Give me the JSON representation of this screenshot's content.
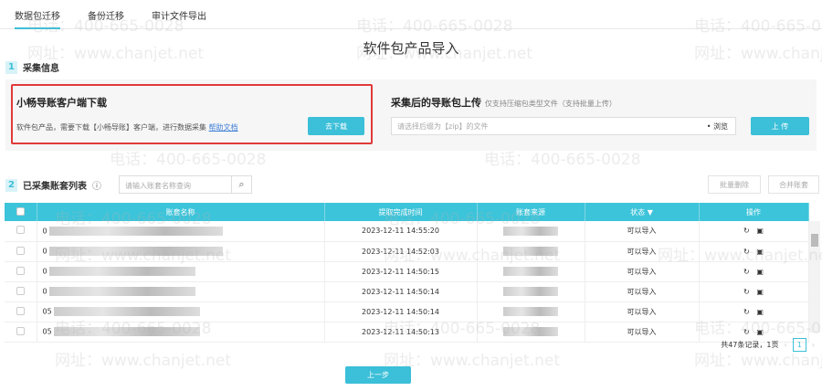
{
  "tabs": [
    "数据包迁移",
    "备份迁移",
    "审计文件导出"
  ],
  "title": "软件包产品导入",
  "section1": {
    "num": "1",
    "label": "采集信息"
  },
  "download": {
    "title": "小畅导账客户端下载",
    "desc": "软件包产品，需要下载【小畅导账】客户端，进行数据采集",
    "help": "帮助文档",
    "button": "去下载"
  },
  "upload": {
    "title": "采集后的导账包上传",
    "hint": "仅支持压缩包类型文件（支持批量上传）",
    "placeholder": "请选择后缀为【zip】的文件",
    "browse": "浏览",
    "button": "上 传"
  },
  "section2": {
    "num": "2",
    "label": "已采集账套列表",
    "search_placeholder": "请输入账套名称查询",
    "batch_delete": "批量删除",
    "merge": "合并账套"
  },
  "table": {
    "headers": [
      "账套名称",
      "提取完成时间",
      "账套来源",
      "状态",
      "操作"
    ],
    "rows": [
      {
        "name": "0",
        "time": "2023-12-11 14:55:20",
        "status": "可以导入"
      },
      {
        "name": "0",
        "time": "2023-12-11 14:52:03",
        "status": "可以导入"
      },
      {
        "name": "0",
        "time": "2023-12-11 14:50:15",
        "status": "可以导入"
      },
      {
        "name": "0",
        "time": "2023-12-11 14:50:14",
        "status": "可以导入"
      },
      {
        "name": "05",
        "time": "2023-12-11 14:50:14",
        "status": "可以导入"
      },
      {
        "name": "05",
        "time": "2023-12-11 14:50:13",
        "status": "可以导入"
      }
    ]
  },
  "pagination": {
    "summary": "共47条记录，1页",
    "page": "1"
  },
  "prev_button": "上一步",
  "watermark": {
    "phone": "电话：400-665-0028",
    "site": "网址：www.chanjet.net"
  }
}
